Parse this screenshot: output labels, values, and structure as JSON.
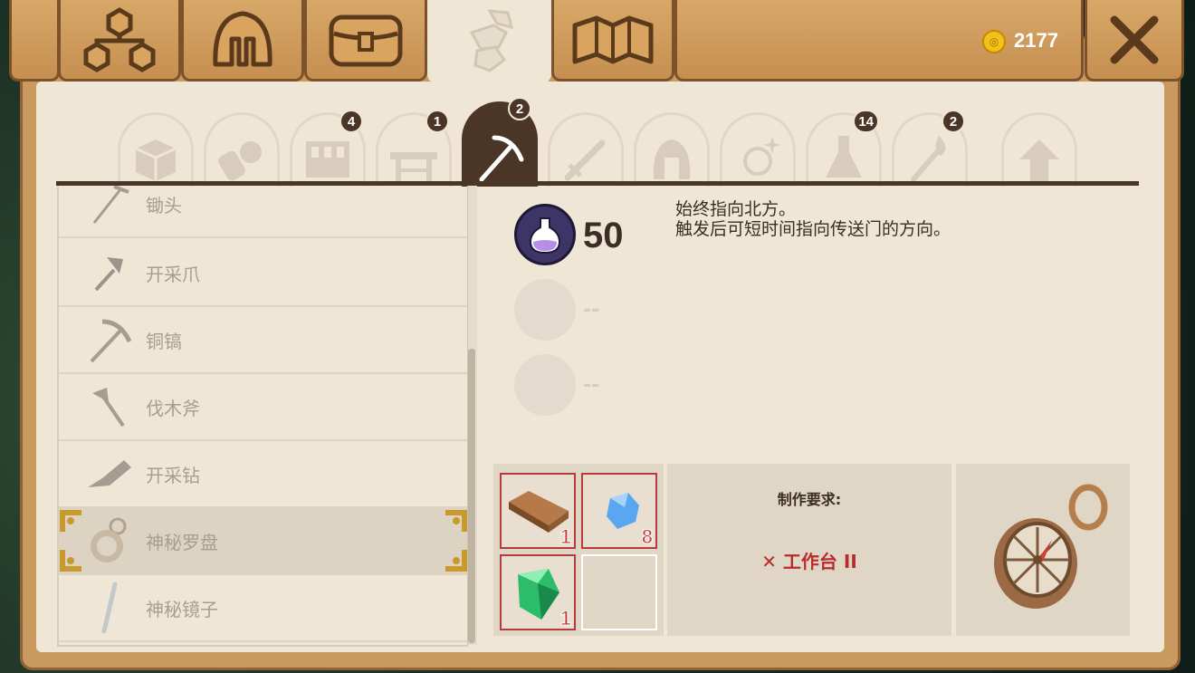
{
  "top_tabs": [
    {
      "name": "skill-tree",
      "icon": "skill-tree-icon"
    },
    {
      "name": "equipment",
      "icon": "helmet-icon"
    },
    {
      "name": "inventory",
      "icon": "bag-icon"
    },
    {
      "name": "crafting",
      "icon": "crafting-hands-icon",
      "active": true
    },
    {
      "name": "map",
      "icon": "map-icon"
    }
  ],
  "currency": {
    "amount": "2177",
    "icon": "gold-coin-icon"
  },
  "categories": [
    {
      "icon": "cube-icon",
      "badge": ""
    },
    {
      "icon": "bandage-icon",
      "badge": ""
    },
    {
      "icon": "machine-icon",
      "badge": "4"
    },
    {
      "icon": "table-icon",
      "badge": "1"
    },
    {
      "icon": "pickaxe-icon",
      "badge": "2",
      "active": true
    },
    {
      "icon": "sword-icon",
      "badge": ""
    },
    {
      "icon": "helmet-icon",
      "badge": ""
    },
    {
      "icon": "sparkle-ring-icon",
      "badge": ""
    },
    {
      "icon": "potion-flask-icon",
      "badge": "14"
    },
    {
      "icon": "torch-icon",
      "badge": "2"
    },
    {
      "icon": "upgrade-arrow-icon",
      "badge": ""
    }
  ],
  "items": [
    {
      "label": "锄头",
      "icon": "hoe-icon"
    },
    {
      "label": "开采爪",
      "icon": "mining-claw-icon"
    },
    {
      "label": "铜镐",
      "icon": "copper-pickaxe-icon"
    },
    {
      "label": "伐木斧",
      "icon": "axe-icon"
    },
    {
      "label": "开采钻",
      "icon": "mining-drill-icon"
    },
    {
      "label": "神秘罗盘",
      "icon": "compass-icon",
      "selected": true
    },
    {
      "label": "神秘镜子",
      "icon": "mirror-icon"
    }
  ],
  "details": {
    "stats": [
      {
        "value": "50",
        "icon": "mana-potion-icon"
      },
      {
        "value": "--"
      },
      {
        "value": "--"
      }
    ],
    "description_line1": "始终指向北方。",
    "description_line2": "触发后可短时间指向传送门的方向。"
  },
  "materials": [
    {
      "icon": "copper-bar-icon",
      "count": "1"
    },
    {
      "icon": "blue-crystal-icon",
      "count": "8"
    },
    {
      "icon": "green-gem-icon",
      "count": "1"
    },
    {
      "icon": "",
      "count": ""
    }
  ],
  "requirements": {
    "title": "制作要求:",
    "item": "✕ 工作台 II"
  },
  "preview": {
    "icon": "compass-preview-icon"
  },
  "colors": {
    "wood": "#c58f50",
    "paper": "#efe6d6",
    "dark": "#4a3527",
    "missing": "#b82c2c"
  }
}
